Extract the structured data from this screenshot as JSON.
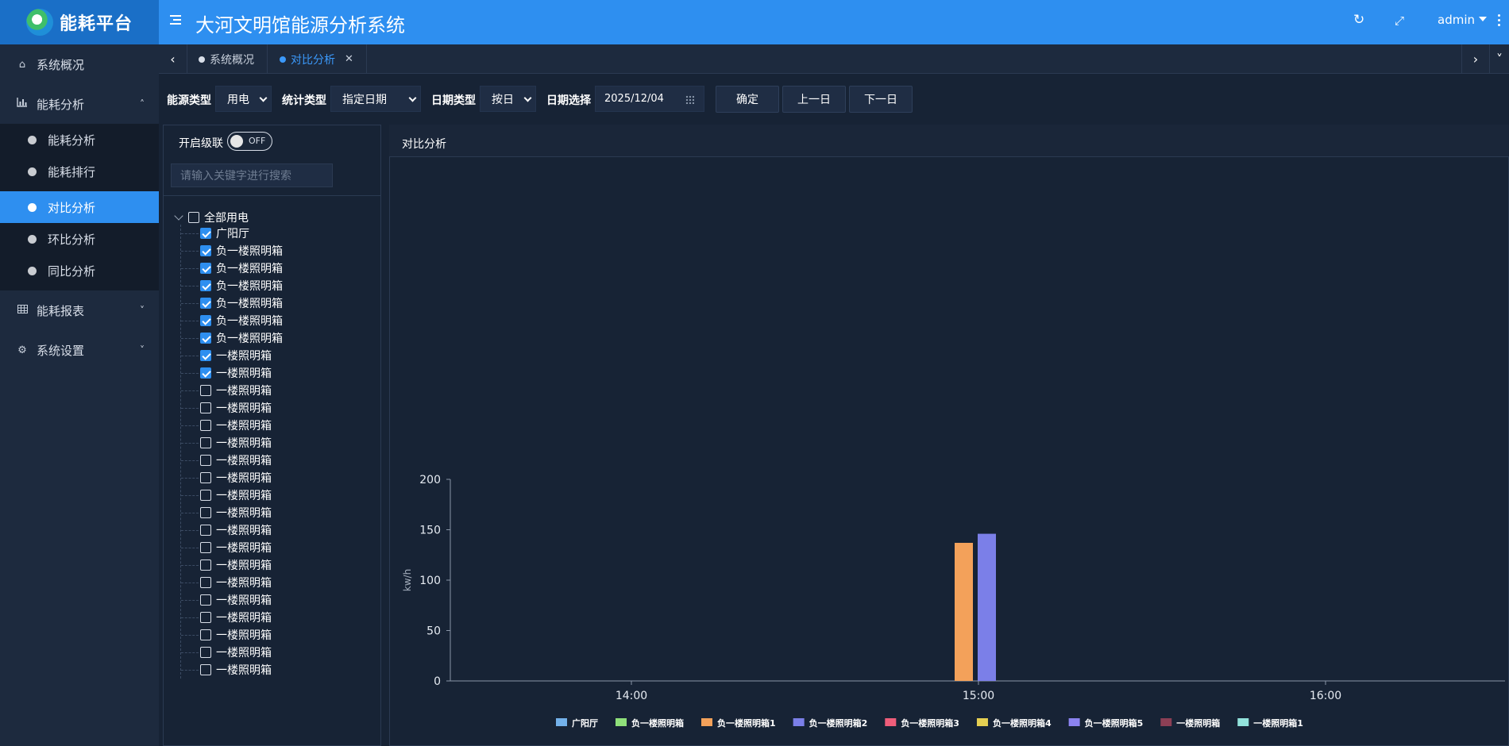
{
  "header": {
    "logo_text": "能耗平台",
    "title": "大河文明馆能源分析系统",
    "user": "admin"
  },
  "sidebar": {
    "items": [
      {
        "label": "系统概况",
        "icon": "home-icon"
      },
      {
        "label": "能耗分析",
        "icon": "bar-chart-icon",
        "expanded": true
      },
      {
        "label": "能耗报表",
        "icon": "table-icon",
        "expanded": false
      },
      {
        "label": "系统设置",
        "icon": "gear-icon",
        "expanded": false
      }
    ],
    "sub_items": [
      {
        "label": "能耗分析"
      },
      {
        "label": "能耗排行"
      },
      {
        "label": "对比分析",
        "active": true
      },
      {
        "label": "环比分析"
      },
      {
        "label": "同比分析"
      }
    ]
  },
  "tabs": [
    {
      "label": "系统概况"
    },
    {
      "label": "对比分析",
      "active": true
    }
  ],
  "filters": {
    "energy_type_label": "能源类型",
    "energy_type_value": "用电",
    "stat_type_label": "统计类型",
    "stat_type_value": "指定日期",
    "date_type_label": "日期类型",
    "date_type_value": "按日",
    "date_label": "日期选择",
    "date_value": "2025/12/04",
    "confirm": "确定",
    "prev_day": "上一日",
    "next_day": "下一日"
  },
  "tree": {
    "cascade_label": "开启级联",
    "cascade_state": "OFF",
    "search_placeholder": "请输入关键字进行搜索",
    "root_label": "全部用电",
    "nodes": [
      {
        "label": "广阳厅",
        "checked": true
      },
      {
        "label": "负一楼照明箱",
        "checked": true
      },
      {
        "label": "负一楼照明箱",
        "checked": true
      },
      {
        "label": "负一楼照明箱",
        "checked": true
      },
      {
        "label": "负一楼照明箱",
        "checked": true
      },
      {
        "label": "负一楼照明箱",
        "checked": true
      },
      {
        "label": "负一楼照明箱",
        "checked": true
      },
      {
        "label": "一楼照明箱",
        "checked": true
      },
      {
        "label": "一楼照明箱",
        "checked": true
      },
      {
        "label": "一楼照明箱",
        "checked": false
      },
      {
        "label": "一楼照明箱",
        "checked": false
      },
      {
        "label": "一楼照明箱",
        "checked": false
      },
      {
        "label": "一楼照明箱",
        "checked": false
      },
      {
        "label": "一楼照明箱",
        "checked": false
      },
      {
        "label": "一楼照明箱",
        "checked": false
      },
      {
        "label": "一楼照明箱",
        "checked": false
      },
      {
        "label": "一楼照明箱",
        "checked": false
      },
      {
        "label": "一楼照明箱",
        "checked": false
      },
      {
        "label": "一楼照明箱",
        "checked": false
      },
      {
        "label": "一楼照明箱",
        "checked": false
      },
      {
        "label": "一楼照明箱",
        "checked": false
      },
      {
        "label": "一楼照明箱",
        "checked": false
      },
      {
        "label": "一楼照明箱",
        "checked": false
      },
      {
        "label": "一楼照明箱",
        "checked": false
      },
      {
        "label": "一楼照明箱",
        "checked": false
      },
      {
        "label": "一楼照明箱",
        "checked": false
      }
    ]
  },
  "panel_title": "对比分析",
  "chart_data": {
    "type": "bar",
    "ylabel": "kw/h",
    "ylim": [
      0,
      200
    ],
    "yticks": [
      0,
      50,
      100,
      150,
      200
    ],
    "x_ticks": [
      "14:00",
      "15:00",
      "16:00"
    ],
    "grid": false,
    "legend_position": "bottom",
    "series": [
      {
        "name": "广阳厅",
        "color": "#73b1ea",
        "x": "15:00",
        "value": null
      },
      {
        "name": "负一楼照明箱",
        "color": "#8fe07a",
        "x": "15:00",
        "value": null
      },
      {
        "name": "负一楼照明箱1",
        "color": "#f3a15a",
        "x": "15:00",
        "value": 137
      },
      {
        "name": "负一楼照明箱2",
        "color": "#7b7fe8",
        "x": "15:00",
        "value": 146
      },
      {
        "name": "负一楼照明箱3",
        "color": "#ef5d7a",
        "x": "15:00",
        "value": null
      },
      {
        "name": "负一楼照明箱4",
        "color": "#e5cf52",
        "x": "15:00",
        "value": null
      },
      {
        "name": "负一楼照明箱5",
        "color": "#8b83f0",
        "x": "15:00",
        "value": null
      },
      {
        "name": "一楼照明箱",
        "color": "#8c3f55",
        "x": "15:00",
        "value": null
      },
      {
        "name": "一楼照明箱1",
        "color": "#92e3dc",
        "x": "15:00",
        "value": null
      }
    ]
  }
}
